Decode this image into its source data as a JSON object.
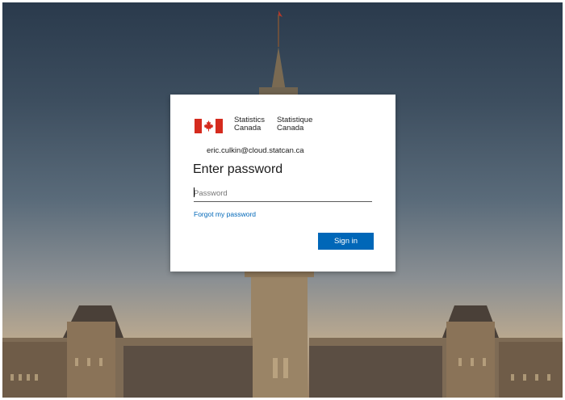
{
  "branding": {
    "english_line1": "Statistics",
    "english_line2": "Canada",
    "french_line1": "Statistique",
    "french_line2": "Canada"
  },
  "account": {
    "email": "eric.culkin@cloud.statcan.ca"
  },
  "form": {
    "title": "Enter password",
    "password_placeholder": "Password",
    "password_value": "",
    "forgot_link": "Forgot my password",
    "submit_label": "Sign in"
  },
  "colors": {
    "accent": "#0067b8",
    "flag_red": "#d52b1e",
    "card_bg": "#ffffff"
  },
  "icons": [
    "canada-flag-icon"
  ]
}
